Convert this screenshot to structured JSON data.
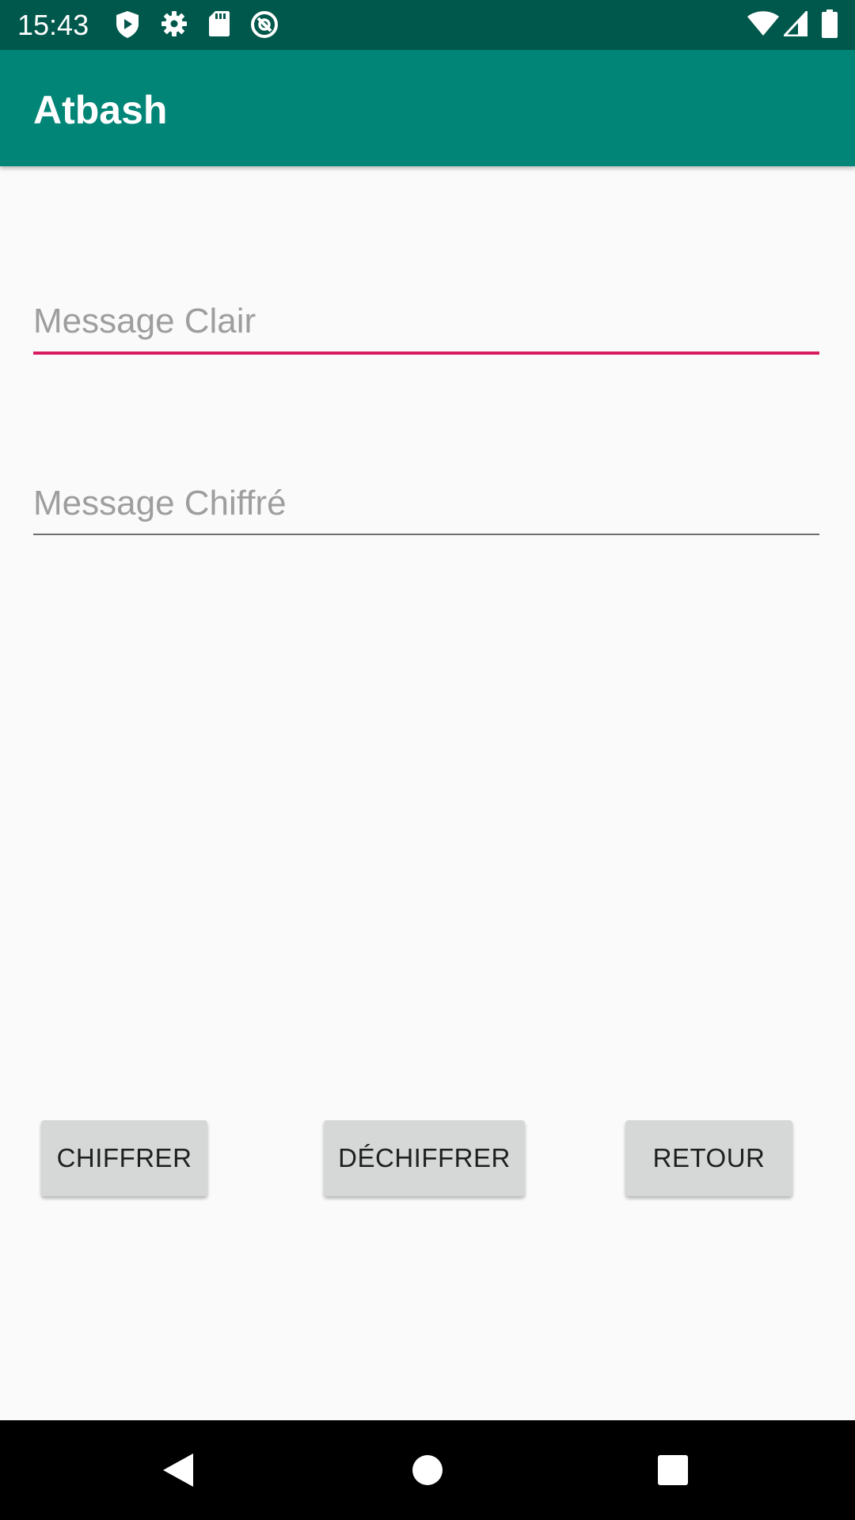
{
  "status_bar": {
    "time": "15:43",
    "left_icons": [
      "shield-play-icon",
      "gear-icon",
      "sd-card-icon",
      "at-sign-icon"
    ],
    "right_icons": [
      "wifi-icon",
      "cell-signal-icon",
      "battery-icon"
    ]
  },
  "app_bar": {
    "title": "Atbash"
  },
  "form": {
    "clear_message": {
      "value": "",
      "placeholder": "Message Clair"
    },
    "cipher_message": {
      "value": "",
      "placeholder": "Message Chiffré"
    }
  },
  "actions": {
    "encrypt_label": "CHIFFRER",
    "decrypt_label": "DÉCHIFFRER",
    "back_label": "RETOUR"
  },
  "nav_bar": {
    "icons": [
      "back-triangle-icon",
      "home-circle-icon",
      "recents-square-icon"
    ]
  },
  "colors": {
    "status_bar": "#00574b",
    "app_bar": "#008577",
    "accent": "#d81b60",
    "button": "#d6d7d7",
    "background": "#fafafa"
  }
}
